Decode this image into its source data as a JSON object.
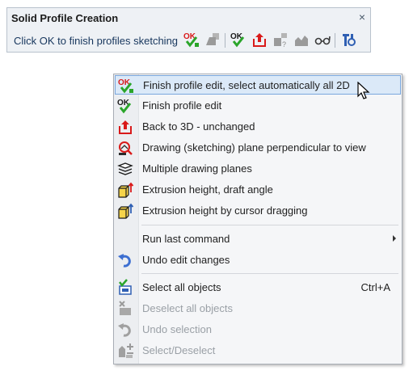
{
  "toolbar": {
    "title": "Solid Profile Creation",
    "close_symbol": "×",
    "message": "Click OK to finish profiles sketching",
    "buttons": [
      {
        "icon": "ok-auto-2d-icon"
      },
      {
        "icon": "shapes-disabled-icon"
      },
      {
        "icon": "ok-check-icon"
      },
      {
        "icon": "back-to-3d-icon"
      },
      {
        "icon": "shapes-edit-disabled-icon"
      },
      {
        "icon": "profile-disabled-icon"
      },
      {
        "icon": "glasses-icon"
      },
      {
        "icon": "tools-icon"
      }
    ]
  },
  "menu": {
    "items": [
      {
        "label": "Finish profile edit, select automatically all 2D",
        "icon": "ok-auto-2d-icon",
        "highlighted": true
      },
      {
        "label": "Finish profile edit",
        "icon": "ok-check-icon"
      },
      {
        "label": "Back to 3D - unchanged",
        "icon": "back-to-3d-icon"
      },
      {
        "label": "Drawing (sketching) plane perpendicular to view",
        "icon": "plane-perpendicular-icon"
      },
      {
        "label": "Multiple drawing planes",
        "icon": "multiple-planes-icon"
      },
      {
        "label": "Extrusion height, draft angle",
        "icon": "extrusion-height-icon"
      },
      {
        "label": "Extrusion height by cursor dragging",
        "icon": "extrusion-drag-icon"
      },
      {
        "label": "Run last command",
        "has_submenu": true
      },
      {
        "label": "Undo edit changes",
        "icon": "undo-icon"
      },
      {
        "label": "Select all objects",
        "icon": "select-all-icon",
        "shortcut": "Ctrl+A"
      },
      {
        "label": "Deselect all objects",
        "icon": "deselect-all-icon",
        "disabled": true
      },
      {
        "label": "Undo selection",
        "icon": "undo-selection-icon",
        "disabled": true
      },
      {
        "label": "Select/Deselect",
        "icon": "select-deselect-icon",
        "disabled": true
      }
    ]
  },
  "colors": {
    "accent_red": "#d91a1a",
    "accent_green": "#2aa52a",
    "accent_blue": "#2f5fb3",
    "highlight_bg": "#dbe9f8",
    "highlight_border": "#7aa7dd",
    "disabled_text": "#9aa0a6"
  }
}
